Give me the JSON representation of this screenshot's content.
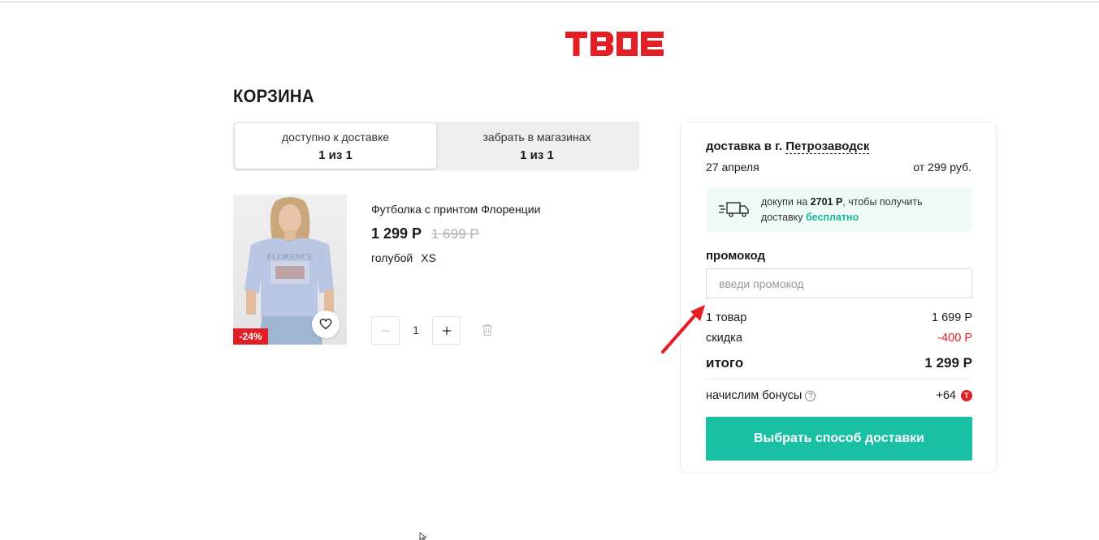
{
  "brand": {
    "logo_text": "TBOE"
  },
  "page": {
    "title": "КОРЗИНА"
  },
  "tabs": [
    {
      "label": "доступно к доставке",
      "count": "1 из 1",
      "active": true
    },
    {
      "label": "забрать в магазинах",
      "count": "1 из 1",
      "active": false
    }
  ],
  "product": {
    "name": "Футболка с принтом Флоренции",
    "price": "1 299 Р",
    "old_price": "1 699 Р",
    "color": "голубой",
    "size": "XS",
    "discount": "-24%",
    "image_print_text": "FLORENCE",
    "quantity": "1"
  },
  "summary": {
    "delivery_prefix": "доставка в г.",
    "city": "Петрозаводск",
    "date": "27 апреля",
    "cost": "от 299 руб.",
    "free_pre": "докупи на",
    "free_amount": "2701 Р",
    "free_mid": ", чтобы получить доставку",
    "free_word": "бесплатно",
    "promo_label": "промокод",
    "promo_placeholder": "введи промокод",
    "items_label": "1 товар",
    "items_value": "1 699 Р",
    "discount_label": "скидка",
    "discount_value": "-400 Р",
    "total_label": "итого",
    "total_value": "1 299 Р",
    "bonus_label": "начислим бонусы",
    "bonus_value": "+64",
    "bonus_coin": "T",
    "cta": "Выбрать способ доставки"
  },
  "colors": {
    "brand_red": "#e31e24",
    "accent_green": "#19c0a4",
    "annotation_arrow": "#e31e24"
  }
}
